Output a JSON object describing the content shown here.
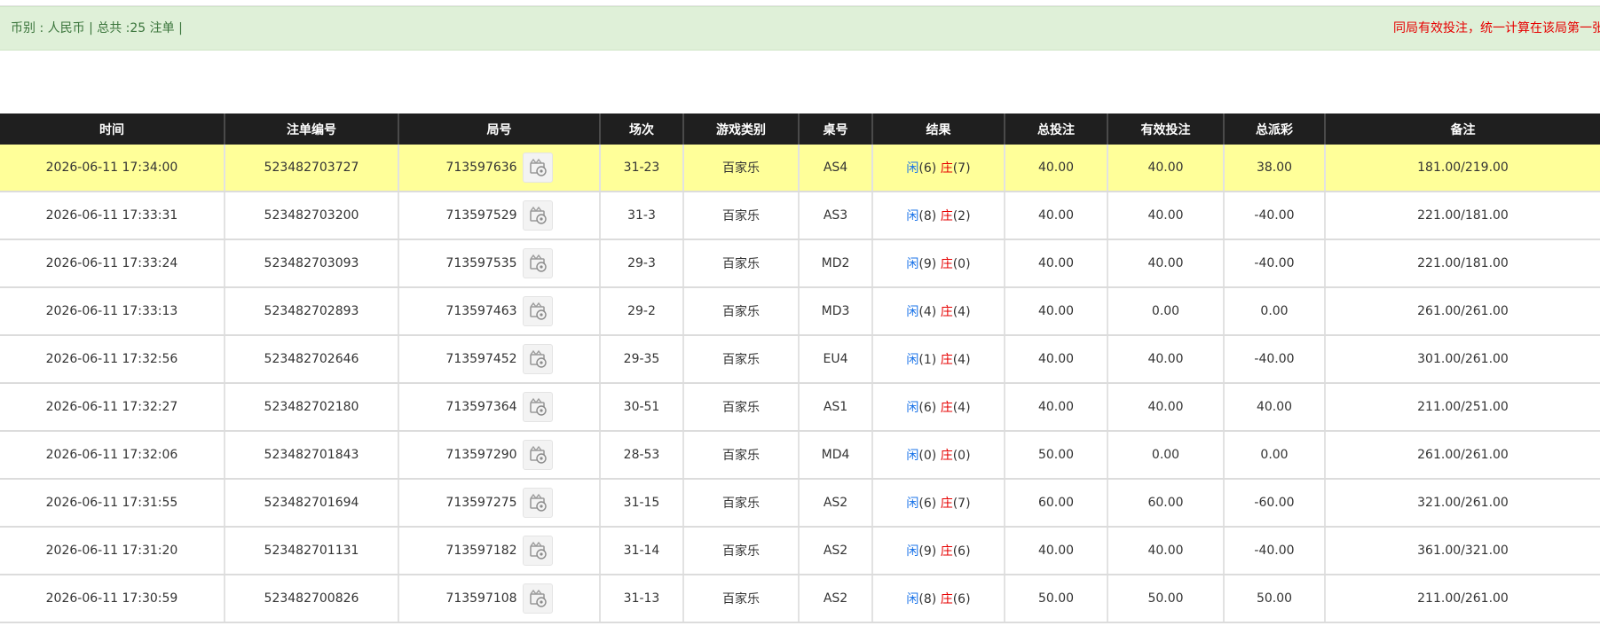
{
  "info": {
    "summary": "币别 : 人民币 | 总共 :25 注单 |",
    "notice": "同局有效投注，统一计算在该局第一张"
  },
  "headers": [
    "时间",
    "注单编号",
    "局号",
    "场次",
    "游戏类别",
    "桌号",
    "结果",
    "总投注",
    "有效投注",
    "总派彩",
    "备注"
  ],
  "result_labels": {
    "player": "闲",
    "banker": "庄"
  },
  "colors": {
    "header_bg": "#1f1f1f",
    "highlight_row": "#ffff99",
    "info_bg": "#dff0d8",
    "blue": "#1a73e8",
    "red": "#e60000"
  },
  "replay_icon": "video-replay-icon",
  "rows": [
    {
      "time": "2026-06-11 17:34:00",
      "order": "523482703727",
      "round": "713597636",
      "session": "31-23",
      "game": "百家乐",
      "table": "AS4",
      "p": "(6)",
      "b": "(7)",
      "bet": "40.00",
      "valid": "40.00",
      "payout": "38.00",
      "payout_neg": false,
      "note": "181.00/219.00",
      "highlight": true
    },
    {
      "time": "2026-06-11 17:33:31",
      "order": "523482703200",
      "round": "713597529",
      "session": "31-3",
      "game": "百家乐",
      "table": "AS3",
      "p": "(8)",
      "b": "(2)",
      "bet": "40.00",
      "valid": "40.00",
      "payout": "-40.00",
      "payout_neg": true,
      "note": "221.00/181.00",
      "highlight": false
    },
    {
      "time": "2026-06-11 17:33:24",
      "order": "523482703093",
      "round": "713597535",
      "session": "29-3",
      "game": "百家乐",
      "table": "MD2",
      "p": "(9)",
      "b": "(0)",
      "bet": "40.00",
      "valid": "40.00",
      "payout": "-40.00",
      "payout_neg": true,
      "note": "221.00/181.00",
      "highlight": false
    },
    {
      "time": "2026-06-11 17:33:13",
      "order": "523482702893",
      "round": "713597463",
      "session": "29-2",
      "game": "百家乐",
      "table": "MD3",
      "p": "(4)",
      "b": "(4)",
      "bet": "40.00",
      "valid": "0.00",
      "payout": "0.00",
      "payout_neg": false,
      "note": "261.00/261.00",
      "highlight": false
    },
    {
      "time": "2026-06-11 17:32:56",
      "order": "523482702646",
      "round": "713597452",
      "session": "29-35",
      "game": "百家乐",
      "table": "EU4",
      "p": "(1)",
      "b": "(4)",
      "bet": "40.00",
      "valid": "40.00",
      "payout": "-40.00",
      "payout_neg": true,
      "note": "301.00/261.00",
      "highlight": false
    },
    {
      "time": "2026-06-11 17:32:27",
      "order": "523482702180",
      "round": "713597364",
      "session": "30-51",
      "game": "百家乐",
      "table": "AS1",
      "p": "(6)",
      "b": "(4)",
      "bet": "40.00",
      "valid": "40.00",
      "payout": "40.00",
      "payout_neg": false,
      "note": "211.00/251.00",
      "highlight": false
    },
    {
      "time": "2026-06-11 17:32:06",
      "order": "523482701843",
      "round": "713597290",
      "session": "28-53",
      "game": "百家乐",
      "table": "MD4",
      "p": "(0)",
      "b": "(0)",
      "bet": "50.00",
      "valid": "0.00",
      "payout": "0.00",
      "payout_neg": false,
      "note": "261.00/261.00",
      "highlight": false
    },
    {
      "time": "2026-06-11 17:31:55",
      "order": "523482701694",
      "round": "713597275",
      "session": "31-15",
      "game": "百家乐",
      "table": "AS2",
      "p": "(6)",
      "b": "(7)",
      "bet": "60.00",
      "valid": "60.00",
      "payout": "-60.00",
      "payout_neg": true,
      "note": "321.00/261.00",
      "highlight": false
    },
    {
      "time": "2026-06-11 17:31:20",
      "order": "523482701131",
      "round": "713597182",
      "session": "31-14",
      "game": "百家乐",
      "table": "AS2",
      "p": "(9)",
      "b": "(6)",
      "bet": "40.00",
      "valid": "40.00",
      "payout": "-40.00",
      "payout_neg": true,
      "note": "361.00/321.00",
      "highlight": false
    },
    {
      "time": "2026-06-11 17:30:59",
      "order": "523482700826",
      "round": "713597108",
      "session": "31-13",
      "game": "百家乐",
      "table": "AS2",
      "p": "(8)",
      "b": "(6)",
      "bet": "50.00",
      "valid": "50.00",
      "payout": "50.00",
      "payout_neg": false,
      "note": "211.00/261.00",
      "highlight": false
    }
  ]
}
